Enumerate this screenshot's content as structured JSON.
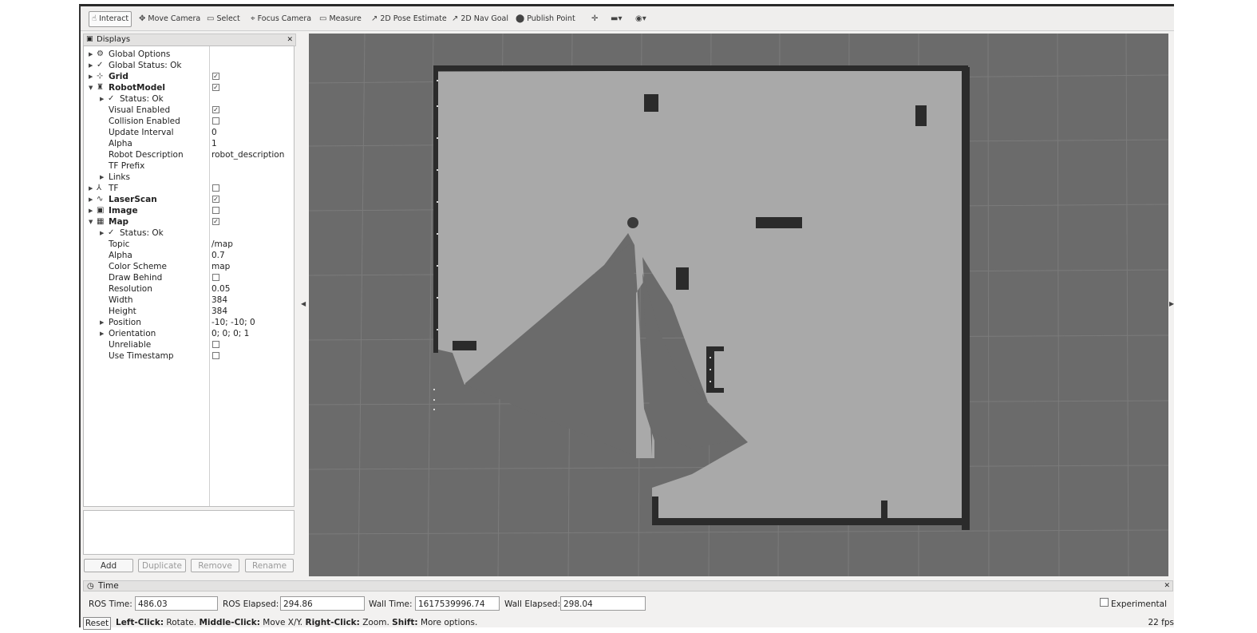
{
  "toolbar": {
    "interact": "Interact",
    "move_camera": "Move Camera",
    "select": "Select",
    "focus_camera": "Focus Camera",
    "measure": "Measure",
    "pose_estimate": "2D Pose Estimate",
    "nav_goal": "2D Nav Goal",
    "publish_point": "Publish Point"
  },
  "displays": {
    "title": "Displays",
    "rows": [
      {
        "label": "Global Options",
        "bold": false
      },
      {
        "label": "Global Status: Ok"
      },
      {
        "label": "Grid",
        "checked": true
      },
      {
        "label": "RobotModel",
        "checked": true
      },
      {
        "label": "Status: Ok"
      },
      {
        "label": "Visual Enabled",
        "checked": true
      },
      {
        "label": "Collision Enabled",
        "checked": false
      },
      {
        "label": "Update Interval",
        "value": "0"
      },
      {
        "label": "Alpha",
        "value": "1"
      },
      {
        "label": "Robot Description",
        "value": "robot_description"
      },
      {
        "label": "TF Prefix",
        "value": ""
      },
      {
        "label": "Links"
      },
      {
        "label": "TF",
        "checked": false
      },
      {
        "label": "LaserScan",
        "checked": true
      },
      {
        "label": "Image",
        "checked": false
      },
      {
        "label": "Map",
        "checked": true
      },
      {
        "label": "Status: Ok"
      },
      {
        "label": "Topic",
        "value": "/map"
      },
      {
        "label": "Alpha",
        "value": "0.7"
      },
      {
        "label": "Color Scheme",
        "value": "map"
      },
      {
        "label": "Draw Behind",
        "checked": false
      },
      {
        "label": "Resolution",
        "value": "0.05"
      },
      {
        "label": "Width",
        "value": "384"
      },
      {
        "label": "Height",
        "value": "384"
      },
      {
        "label": "Position",
        "value": "-10; -10; 0"
      },
      {
        "label": "Orientation",
        "value": "0; 0; 0; 1"
      },
      {
        "label": "Unreliable",
        "checked": false
      },
      {
        "label": "Use Timestamp",
        "checked": false
      }
    ],
    "buttons": {
      "add": "Add",
      "duplicate": "Duplicate",
      "remove": "Remove",
      "rename": "Rename"
    }
  },
  "time": {
    "title": "Time",
    "ros_time_label": "ROS Time:",
    "ros_time": "486.03",
    "ros_elapsed_label": "ROS Elapsed:",
    "ros_elapsed": "294.86",
    "wall_time_label": "Wall Time:",
    "wall_time": "1617539996.74",
    "wall_elapsed_label": "Wall Elapsed:",
    "wall_elapsed": "298.04",
    "experimental_label": "Experimental"
  },
  "status": {
    "reset": "Reset",
    "left_click": "Left-Click:",
    "left_click_action": "Rotate.",
    "middle_click": "Middle-Click:",
    "middle_click_action": "Move X/Y.",
    "right_click": "Right-Click:",
    "right_click_action": "Zoom.",
    "shift": "Shift:",
    "shift_action": "More options.",
    "fps": "22 fps"
  }
}
